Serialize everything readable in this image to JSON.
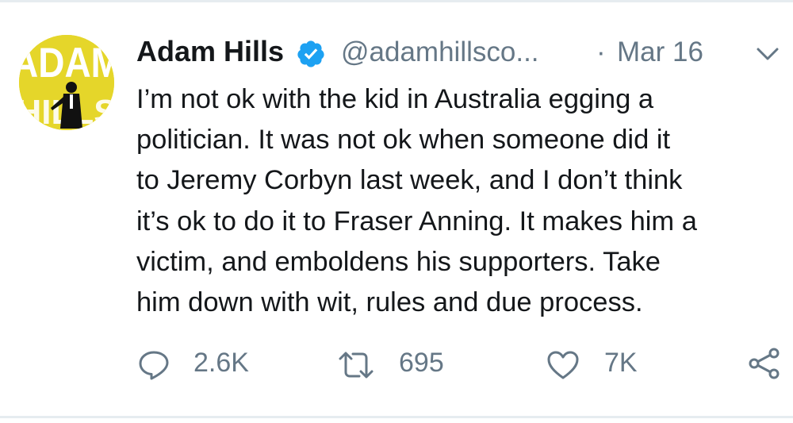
{
  "tweet": {
    "author": {
      "display_name": "Adam Hills",
      "handle": "@adamhillsco...",
      "avatar_text": "ADAM HILLS"
    },
    "separator": "·",
    "date": "Mar 16",
    "text_lines": [
      "I’m not ok with the kid in Australia egging a",
      "politician. It was not ok when someone did it",
      "to Jeremy Corbyn last week, and I don’t think",
      "it’s ok to do it to Fraser Anning. It makes him a",
      "victim, and emboldens his supporters. Take",
      "him down with wit, rules and due process."
    ],
    "actions": {
      "reply_count": "2.6K",
      "retweet_count": "695",
      "like_count": "7K"
    }
  },
  "colors": {
    "text": "#14171a",
    "secondary": "#657786",
    "verified": "#1da1f2",
    "avatar_bg": "#e5d62a",
    "divider": "#e6ecf0"
  },
  "icons": {
    "verified": "verified-badge-icon",
    "menu": "chevron-down-icon",
    "reply": "reply-icon",
    "retweet": "retweet-icon",
    "like": "heart-icon",
    "share": "share-icon"
  }
}
